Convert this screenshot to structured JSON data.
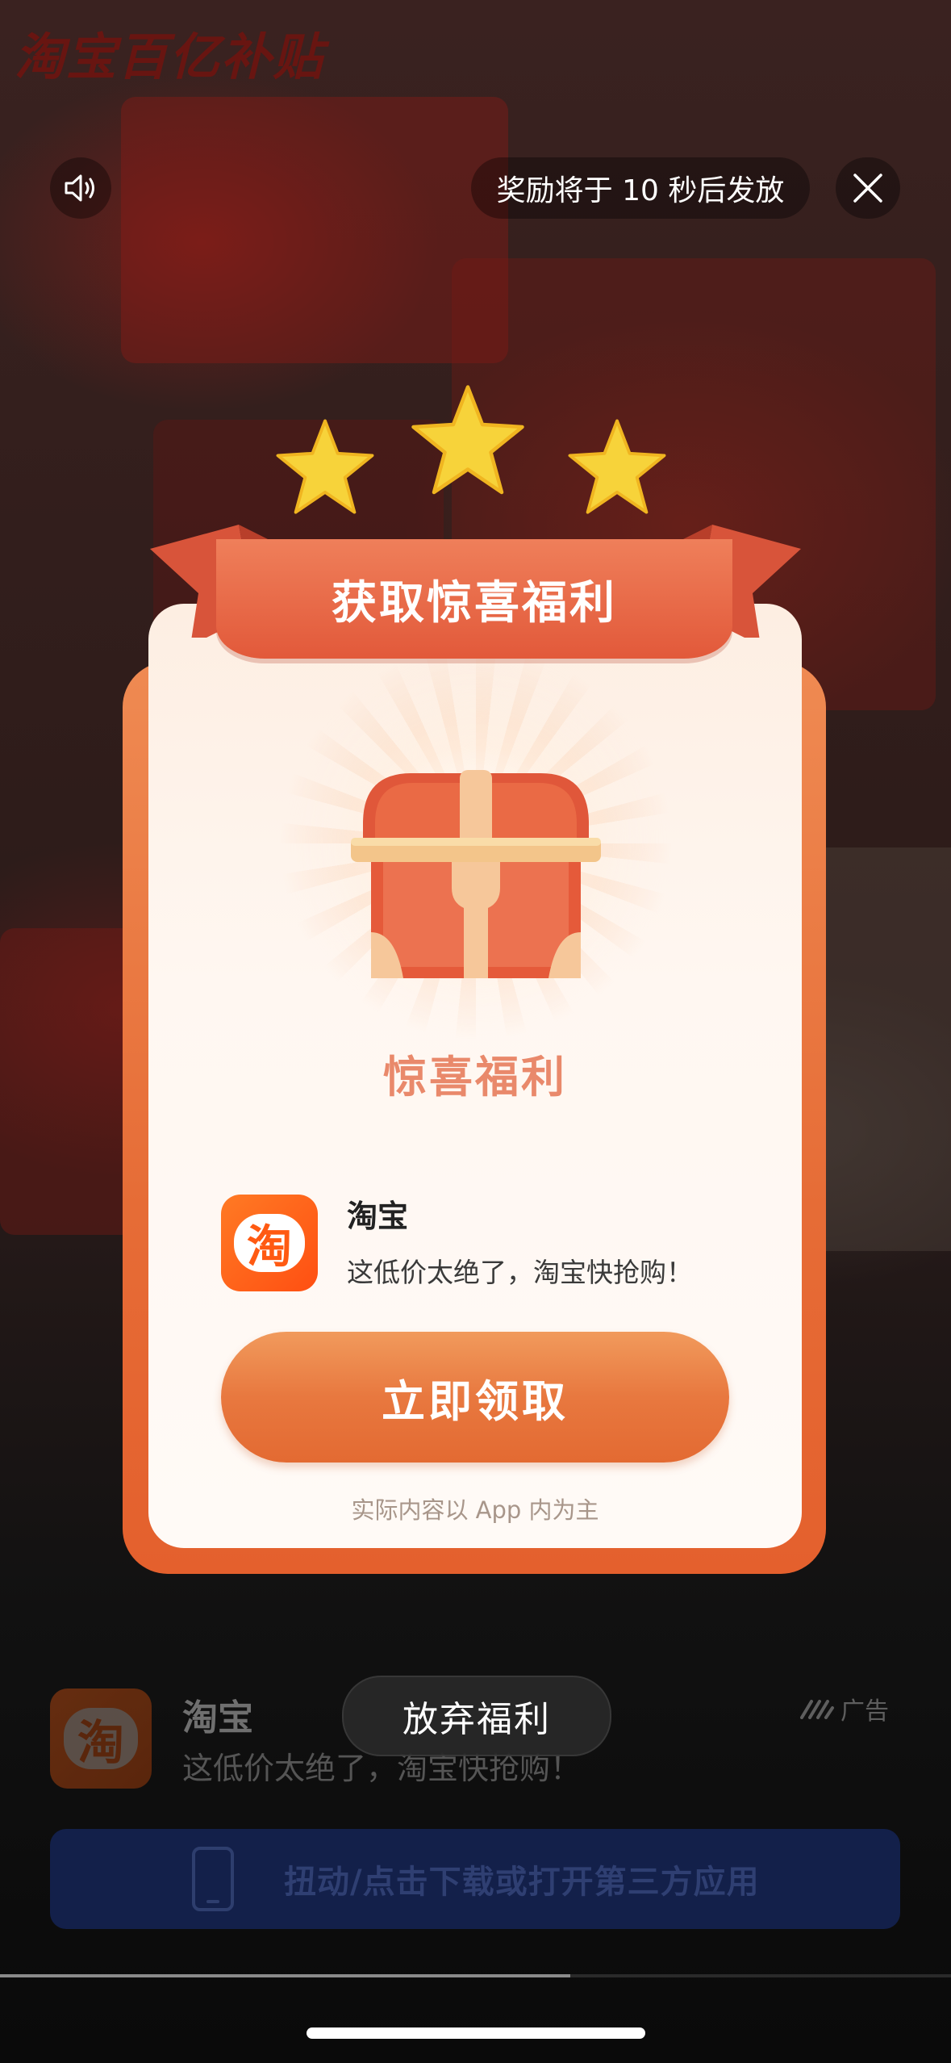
{
  "background": {
    "title": "淘宝百亿补贴"
  },
  "top_bar": {
    "sound_icon": "speaker-icon",
    "countdown_text": "奖励将于 10 秒后发放",
    "close_icon": "close-icon"
  },
  "modal": {
    "title": "获取惊喜福利",
    "stars": 3,
    "chest_icon": "treasure-chest-icon",
    "chest_label": "惊喜福利",
    "app": {
      "icon_glyph": "淘",
      "name": "淘宝",
      "description": "这低价太绝了，淘宝快抢购！"
    },
    "claim_button": "立即领取",
    "disclaimer": "实际内容以 App 内为主"
  },
  "ad": {
    "app_icon_glyph": "淘",
    "app_name": "淘宝",
    "app_description": "这低价太绝了，淘宝快抢购！",
    "ad_label": "广告",
    "ad_logo_icon": "ad-brand-icon",
    "giveup_button": "放弃福利",
    "download_button": "扭动/点击下载或打开第三方应用",
    "download_icon": "phone-icon"
  },
  "video_progress": 0.6,
  "colors": {
    "accent_orange": "#e8783f",
    "ribbon_red": "#e2593a",
    "taobao_orange": "#ff5a12",
    "download_bg": "#13204a"
  }
}
